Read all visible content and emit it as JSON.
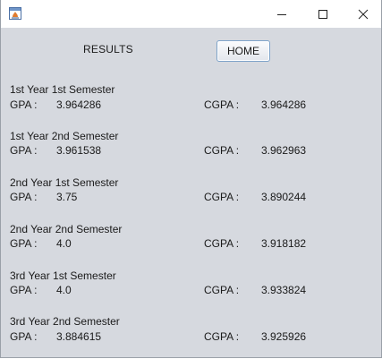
{
  "window": {
    "icon": "java-app-icon",
    "controls": {
      "minimize_icon": "minimize-icon",
      "maximize_icon": "maximize-icon",
      "close_icon": "close-icon"
    }
  },
  "header": {
    "title": "RESULTS",
    "home_label": "HOME"
  },
  "results": [
    {
      "semester": "1st Year 1st Semester",
      "gpa_label": "GPA :",
      "gpa": "3.964286",
      "cgpa_label": "CGPA :",
      "cgpa": "3.964286"
    },
    {
      "semester": "1st Year 2nd Semester",
      "gpa_label": "GPA :",
      "gpa": "3.961538",
      "cgpa_label": "CGPA :",
      "cgpa": "3.962963"
    },
    {
      "semester": "2nd Year 1st Semester",
      "gpa_label": "GPA :",
      "gpa": "3.75",
      "cgpa_label": "CGPA :",
      "cgpa": "3.890244"
    },
    {
      "semester": "2nd Year 2nd Semester",
      "gpa_label": "GPA :",
      "gpa": "4.0",
      "cgpa_label": "CGPA :",
      "cgpa": "3.918182"
    },
    {
      "semester": "3rd Year 1st Semester",
      "gpa_label": "GPA :",
      "gpa": "4.0",
      "cgpa_label": "CGPA :",
      "cgpa": "3.933824"
    },
    {
      "semester": "3rd Year 2nd Semester",
      "gpa_label": "GPA :",
      "gpa": "3.884615",
      "cgpa_label": "CGPA :",
      "cgpa": "3.925926"
    }
  ],
  "colors": {
    "client_background": "#d6d9df",
    "button_border": "#7ea3c9"
  }
}
